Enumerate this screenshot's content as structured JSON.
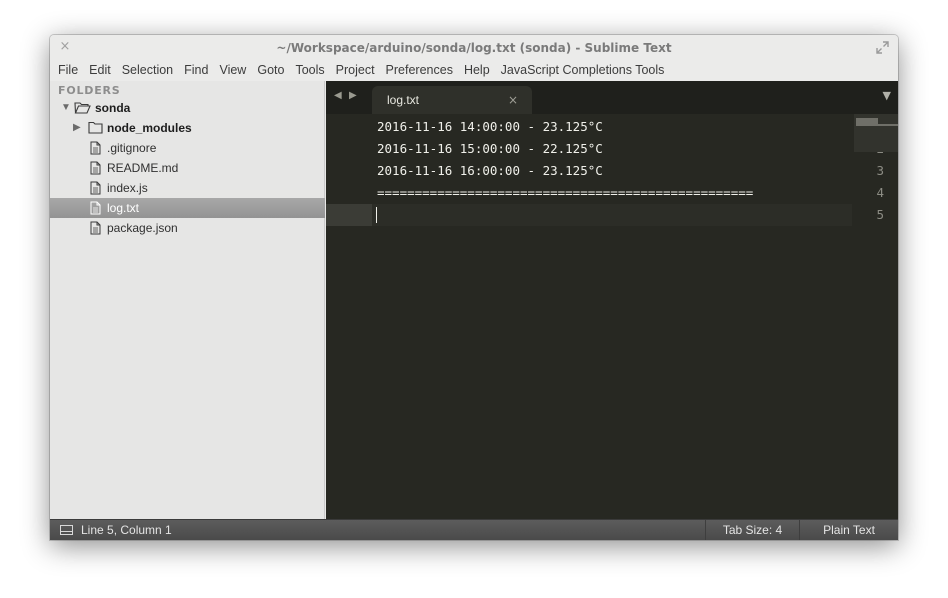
{
  "window": {
    "title": "~/Workspace/arduino/sonda/log.txt (sonda) - Sublime Text",
    "close_glyph": "×"
  },
  "menu": {
    "items": [
      "File",
      "Edit",
      "Selection",
      "Find",
      "View",
      "Goto",
      "Tools",
      "Project",
      "Preferences",
      "Help",
      "JavaScript Completions Tools"
    ]
  },
  "sidebar": {
    "header": "FOLDERS",
    "root": "sonda",
    "items": [
      {
        "label": "node_modules",
        "type": "folder"
      },
      {
        "label": ".gitignore",
        "type": "file"
      },
      {
        "label": "README.md",
        "type": "file"
      },
      {
        "label": "index.js",
        "type": "file"
      },
      {
        "label": "log.txt",
        "type": "file",
        "selected": true
      },
      {
        "label": "package.json",
        "type": "file"
      }
    ]
  },
  "editor": {
    "tab_label": "log.txt",
    "tab_close": "×",
    "lines": [
      {
        "num": "1",
        "text": "2016-11-16 14:00:00 - 23.125°C"
      },
      {
        "num": "2",
        "text": "2016-11-16 15:00:00 - 22.125°C"
      },
      {
        "num": "3",
        "text": "2016-11-16 16:00:00 - 23.125°C"
      },
      {
        "num": "4",
        "text": "=================================================="
      },
      {
        "num": "5",
        "text": ""
      }
    ]
  },
  "statusbar": {
    "position": "Line 5, Column 1",
    "tab_size": "Tab Size: 4",
    "syntax": "Plain Text"
  },
  "colors": {
    "editor_bg": "#272822",
    "sidebar_bg": "#e6e6e5",
    "selection_bg": "#9e9e9e",
    "statusbar_bg": "#4f4f4f"
  }
}
